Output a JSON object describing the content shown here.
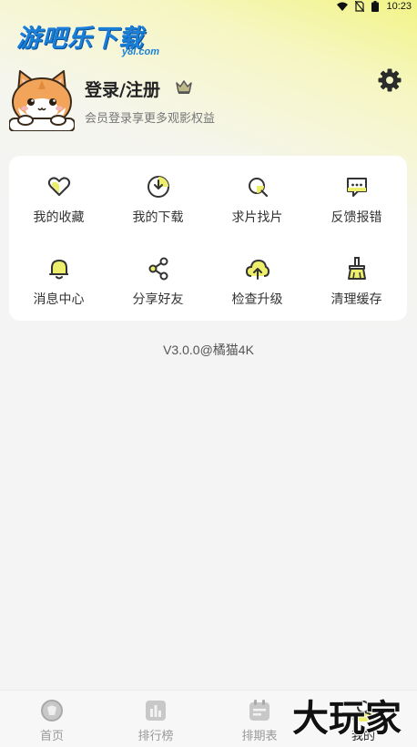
{
  "status_bar": {
    "time": "10:23",
    "icons": [
      "wifi-icon",
      "no-sim-icon",
      "battery-icon"
    ]
  },
  "brand": {
    "title": "游吧乐下载",
    "subtitle": "y8l.com"
  },
  "profile": {
    "title": "登录/注册",
    "subtitle": "会员登录享更多观影权益",
    "avatar": "cat-avatar",
    "badge_icon": "crown-icon",
    "settings_icon": "gear-icon"
  },
  "menu": {
    "items": [
      {
        "label": "我的收藏",
        "icon": "heart-icon"
      },
      {
        "label": "我的下载",
        "icon": "download-icon"
      },
      {
        "label": "求片找片",
        "icon": "search-icon"
      },
      {
        "label": "反馈报错",
        "icon": "feedback-icon"
      },
      {
        "label": "消息中心",
        "icon": "bell-icon"
      },
      {
        "label": "分享好友",
        "icon": "share-icon"
      },
      {
        "label": "检查升级",
        "icon": "upgrade-icon"
      },
      {
        "label": "清理缓存",
        "icon": "broom-icon"
      }
    ]
  },
  "version": "V3.0.0@橘猫4K",
  "tabbar": {
    "tabs": [
      {
        "label": "首页",
        "icon": "home-icon"
      },
      {
        "label": "排行榜",
        "icon": "ranking-icon"
      },
      {
        "label": "排期表",
        "icon": "calendar-icon"
      },
      {
        "label": "我的",
        "icon": "profile-icon"
      }
    ],
    "active_index": 3
  },
  "watermark": {
    "text": "大玩家"
  },
  "colors": {
    "accent_yellow": "#f0f27a",
    "brand_blue": "#1a7fd6",
    "text_dark": "#222222",
    "text_muted": "#777777",
    "tab_inactive": "#999999"
  }
}
